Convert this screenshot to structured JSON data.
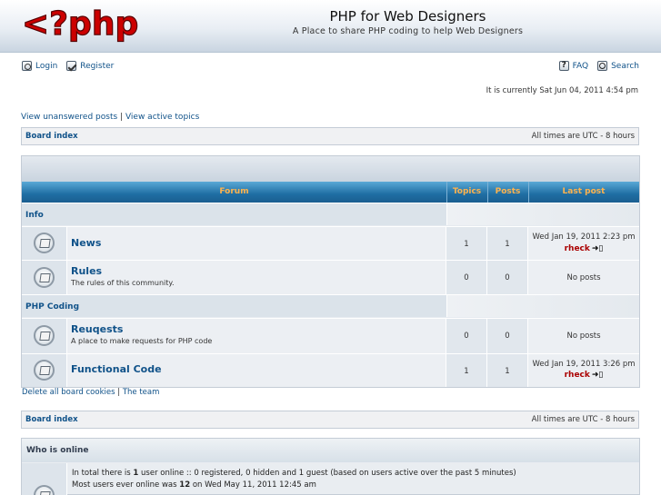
{
  "header": {
    "logo_text": "<?php?>",
    "site_title": "PHP for Web Designers",
    "site_description": "A Place to share PHP coding to help Web Designers"
  },
  "top_menu": {
    "login": "Login",
    "register": "Register",
    "faq": "FAQ",
    "search": "Search"
  },
  "current_time": "It is currently Sat Jun 04, 2011 4:54 pm",
  "view_links": {
    "unanswered": "View unanswered posts",
    "separator": "|",
    "active": "View active topics"
  },
  "navbar": {
    "board_index": "Board index",
    "timezone": "All times are UTC - 8 hours"
  },
  "forum_table": {
    "headers": {
      "forum": "Forum",
      "topics": "Topics",
      "posts": "Posts",
      "last_post": "Last post"
    },
    "categories": [
      {
        "name": "Info",
        "forums": [
          {
            "title": "News",
            "description": "",
            "topics": "1",
            "posts": "1",
            "last_post_date": "Wed Jan 19, 2011 2:23 pm",
            "last_post_user": "rheck"
          },
          {
            "title": "Rules",
            "description": "The rules of this community.",
            "topics": "0",
            "posts": "0",
            "last_post_date": "No posts",
            "last_post_user": ""
          }
        ]
      },
      {
        "name": "PHP Coding",
        "forums": [
          {
            "title": "Reuqests",
            "description": "A place to make requests for PHP code",
            "topics": "0",
            "posts": "0",
            "last_post_date": "No posts",
            "last_post_user": ""
          },
          {
            "title": "Functional Code",
            "description": "",
            "topics": "1",
            "posts": "1",
            "last_post_date": "Wed Jan 19, 2011 3:26 pm",
            "last_post_user": "rheck"
          }
        ]
      }
    ]
  },
  "bottom_links": {
    "delete_cookies": "Delete all board cookies",
    "separator": "|",
    "team": "The team"
  },
  "who_is_online": {
    "title": "Who is online",
    "line1_pre": "In total there is ",
    "line1_count": "1",
    "line1_post": " user online :: 0 registered, 0 hidden and 1 guest (based on users active over the past 5 minutes)",
    "line2_pre": "Most users ever online was ",
    "line2_count": "12",
    "line2_post": " on Wed May 11, 2011 12:45 am"
  },
  "colors": {
    "link": "#105289",
    "header_accent": "#ffb34d",
    "logo_red": "#cc0000",
    "last_post_user": "#aa0000"
  }
}
